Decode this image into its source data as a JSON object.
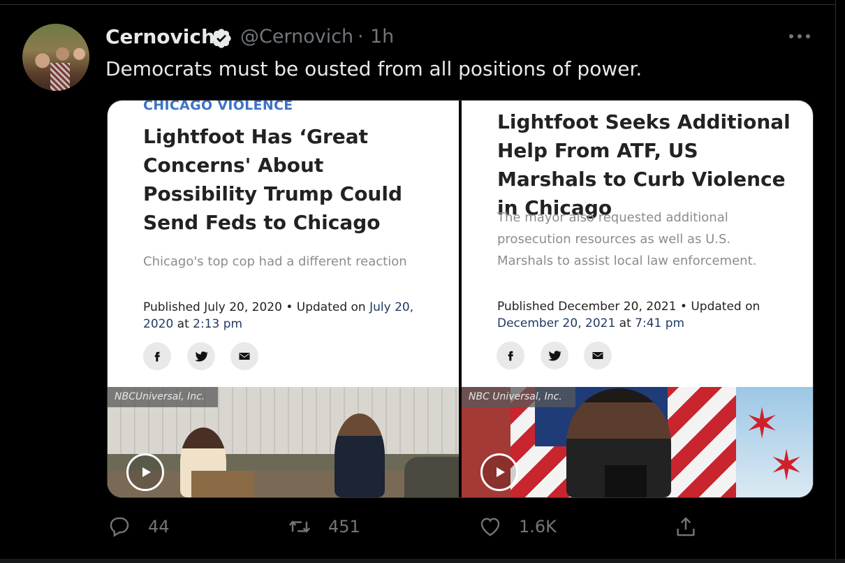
{
  "tweet": {
    "display_name": "Cernovich",
    "handle": "@Cernovich",
    "separator": "·",
    "time": "1h",
    "text": "Democrats must be ousted from all positions of power."
  },
  "cards": [
    {
      "kicker": "CHICAGO VIOLENCE",
      "headline": "Lightfoot Has ‘Great Concerns' About Possibility Trump Could Send Feds to Chicago",
      "dek": "Chicago's top cop had a different reaction",
      "pub_prefix": "Published July 20, 2020 • Updated on ",
      "pub_date_link": "July 20, 2020",
      "pub_at": " at ",
      "pub_time_link": "2:13 pm",
      "photo_credit": "NBCUniversal, Inc."
    },
    {
      "headline": "Lightfoot Seeks Additional Help From ATF, US Marshals to Curb Violence in Chicago",
      "dek": "The mayor also requested additional prosecution resources as well as U.S. Marshals to assist local law enforcement.",
      "pub_prefix": "Published December 20, 2021 • Updated on ",
      "pub_date_link": "December 20, 2021",
      "pub_at": " at ",
      "pub_time_link": "7:41 pm",
      "photo_credit": "NBC Universal, Inc."
    }
  ],
  "share_icons": [
    "facebook-icon",
    "twitter-icon",
    "email-icon"
  ],
  "actions": {
    "reply_count": "44",
    "retweet_count": "451",
    "like_count": "1.6K"
  },
  "colors": {
    "background": "#000000",
    "muted": "#71767b",
    "kicker": "#3c73c9"
  }
}
